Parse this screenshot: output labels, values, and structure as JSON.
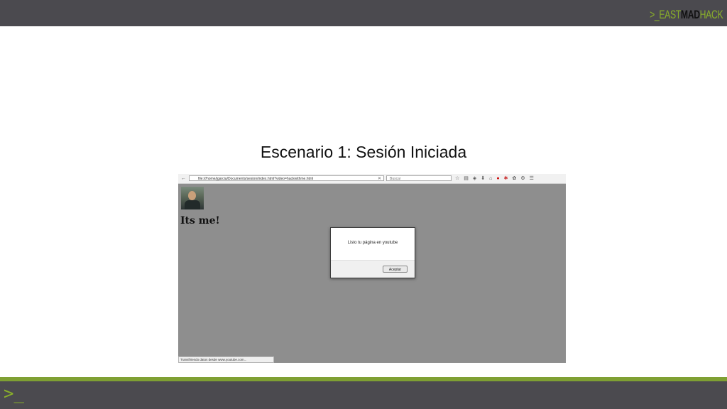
{
  "header": {
    "logo": {
      "prefix": ">_",
      "east": "EAST",
      "mad": "MAD",
      "hack": "HACK"
    }
  },
  "slide": {
    "title": "Escenario 1: Sesión Iniciada"
  },
  "browser": {
    "url": "file:///home/jgarcia/Documents/sesion/index.html?video=hackwithme.html",
    "search_placeholder": "Buscar",
    "page_heading": "Its me!",
    "alert": {
      "message": "Listo tu página en youtube",
      "button_label": "Aceptar"
    },
    "status_text": "Transfiriendo datos desde www.youtube.com..."
  },
  "footer": {
    "prompt": ">_"
  },
  "colors": {
    "bar": "#4b4a4f",
    "accent": "#8ab02a"
  }
}
